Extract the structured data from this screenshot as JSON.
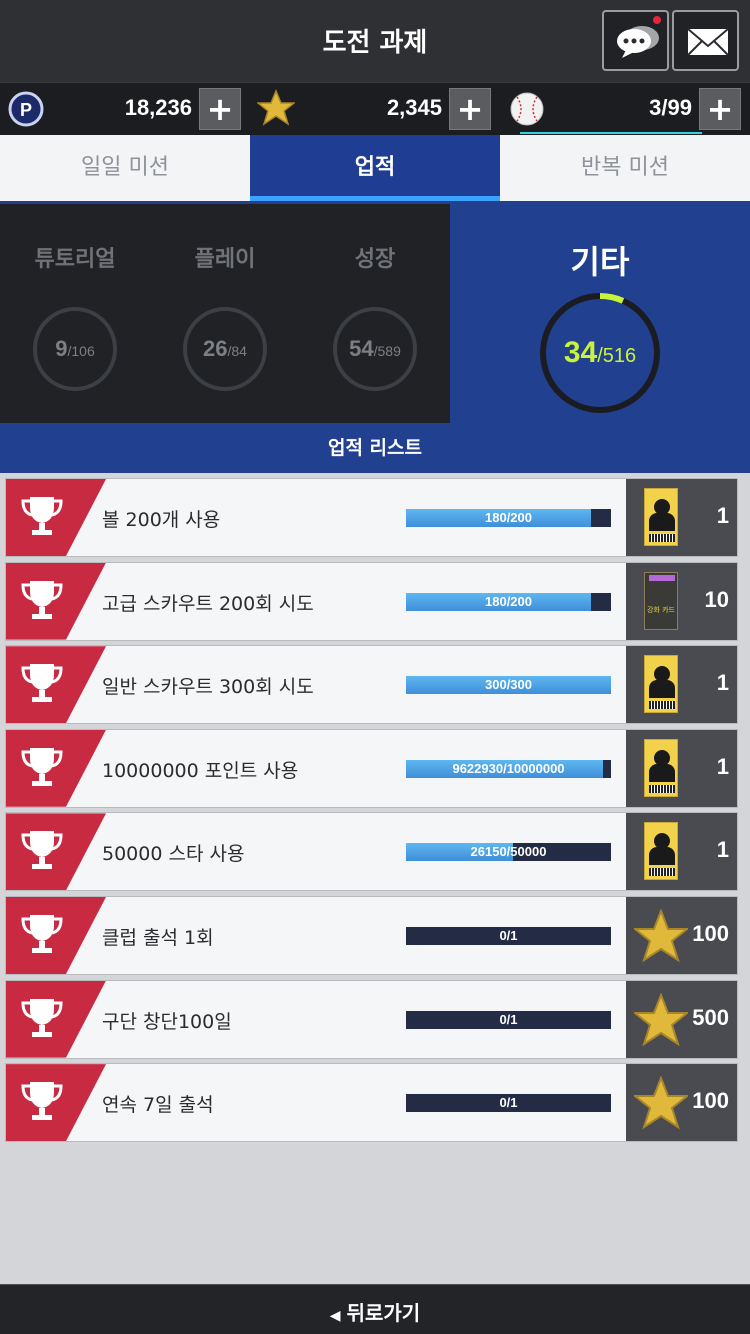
{
  "header": {
    "title": "도전 과제",
    "chat_icon": "chat-bubble-icon",
    "mail_icon": "envelope-icon"
  },
  "currency": {
    "points": {
      "icon": "points-icon",
      "letter": "P",
      "value": "18,236"
    },
    "stars": {
      "icon": "star-icon",
      "value": "2,345"
    },
    "balls": {
      "icon": "baseball-icon",
      "value": "3/99"
    },
    "plus": "+"
  },
  "tabs": [
    {
      "label": "일일 미션",
      "active": false
    },
    {
      "label": "업적",
      "active": true
    },
    {
      "label": "반복 미션",
      "active": false
    }
  ],
  "categories": [
    {
      "label": "튜토리얼",
      "count": "9",
      "total": "/106"
    },
    {
      "label": "플레이",
      "count": "26",
      "total": "/84"
    },
    {
      "label": "성장",
      "count": "54",
      "total": "/589"
    }
  ],
  "selected_category": {
    "label": "기타",
    "count": "34",
    "total": "/516",
    "progress": 0.066
  },
  "list_title": "업적 리스트",
  "achievements": [
    {
      "label": "볼 200개 사용",
      "progress_text": "180/200",
      "progress": 0.9,
      "reward_icon": "player-card-icon",
      "reward_qty": "1"
    },
    {
      "label": "고급 스카우트 200회 시도",
      "progress_text": "180/200",
      "progress": 0.9,
      "reward_icon": "premium-card-icon",
      "reward_card_text": "강화 카드",
      "reward_qty": "10"
    },
    {
      "label": "일반 스카우트 300회 시도",
      "progress_text": "300/300",
      "progress": 1.0,
      "reward_icon": "player-card-icon",
      "reward_qty": "1"
    },
    {
      "label": "10000000 포인트 사용",
      "progress_text": "9622930/10000000",
      "progress": 0.962,
      "reward_icon": "player-card-icon",
      "reward_qty": "1"
    },
    {
      "label": "50000 스타 사용",
      "progress_text": "26150/50000",
      "progress": 0.523,
      "reward_icon": "player-card-icon",
      "reward_qty": "1"
    },
    {
      "label": "클럽 출석 1회",
      "progress_text": "0/1",
      "progress": 0,
      "reward_icon": "star-icon",
      "reward_qty": "100"
    },
    {
      "label": "구단 창단100일",
      "progress_text": "0/1",
      "progress": 0,
      "reward_icon": "star-icon",
      "reward_qty": "500"
    },
    {
      "label": "연속 7일 출석",
      "progress_text": "0/1",
      "progress": 0,
      "reward_icon": "star-icon",
      "reward_qty": "100"
    }
  ],
  "footer": {
    "back_label": "뒤로가기",
    "arrow": "◀"
  },
  "colors": {
    "accent_blue": "#1f3e93",
    "trophy_red": "#c82a42",
    "progress_blue": "#3f8ed9",
    "lime": "#c8f23c"
  }
}
